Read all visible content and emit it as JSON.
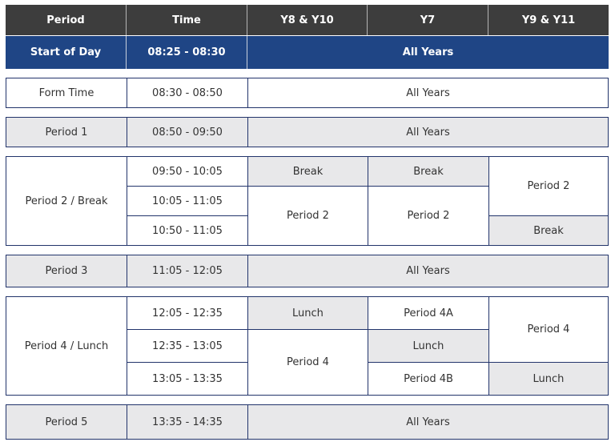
{
  "header": {
    "columns": [
      "Period",
      "Time",
      "Y8 & Y10",
      "Y7",
      "Y9 & Y11"
    ]
  },
  "rows": {
    "start_of_day": {
      "period": "Start of Day",
      "time": "08:25 - 08:30",
      "all": "All Years"
    },
    "form_time": {
      "period": "Form Time",
      "time": "08:30 - 08:50",
      "all": "All Years"
    },
    "period1": {
      "period": "Period 1",
      "time": "08:50 - 09:50",
      "all": "All Years"
    },
    "period2": {
      "period": "Period 2 / Break",
      "times": [
        "09:50 - 10:05",
        "10:05 - 11:05",
        "10:50 - 11:05"
      ],
      "y8y10": [
        "Break",
        "Period 2"
      ],
      "y7": [
        "Break",
        "Period 2"
      ],
      "y9y11": [
        "Period 2",
        "Break"
      ]
    },
    "period3": {
      "period": "Period 3",
      "time": "11:05 - 12:05",
      "all": "All Years"
    },
    "period4": {
      "period": "Period 4 / Lunch",
      "times": [
        "12:05 - 12:35",
        "12:35 - 13:05",
        "13:05 - 13:35"
      ],
      "y8y10": [
        "Lunch",
        "Period 4"
      ],
      "y7": [
        "Period 4A",
        "Lunch",
        "Period 4B"
      ],
      "y9y11": [
        "Period 4",
        "Lunch"
      ]
    },
    "period5": {
      "period": "Period 5",
      "time": "13:35 - 14:35",
      "all": "All Years"
    }
  },
  "colors": {
    "header_bg": "#3d3d3d",
    "start_of_day_bg": "#1f4585",
    "border": "#22346b",
    "grey_cell": "#e8e8ea"
  }
}
